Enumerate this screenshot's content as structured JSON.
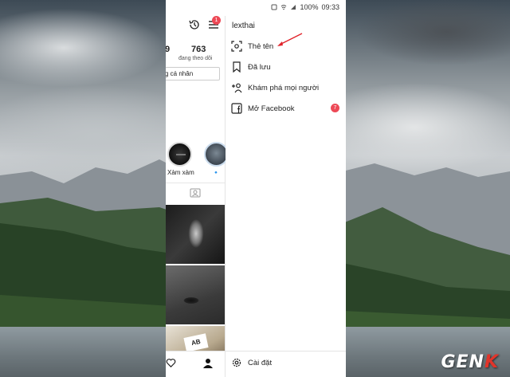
{
  "statusbar": {
    "time": "09:33",
    "battery": "100%"
  },
  "profile": {
    "stat_value": "763",
    "stat_label": "đang theo dõi",
    "left_value": "9",
    "edit_button": "g cá nhân",
    "menu_badge": "1",
    "highlights": [
      {
        "label": "Xàm xàm"
      },
      {
        "label": "🔹"
      }
    ],
    "photo_card_text": "AB"
  },
  "drawer": {
    "username": "lexthai",
    "items": [
      {
        "label": "Thẻ tên",
        "icon": "nametag-icon"
      },
      {
        "label": "Đã lưu",
        "icon": "bookmark-icon"
      },
      {
        "label": "Khám phá mọi người",
        "icon": "add-person-icon"
      },
      {
        "label": "Mở Facebook",
        "icon": "facebook-icon",
        "badge": "7"
      }
    ],
    "settings_label": "Cài đặt"
  },
  "watermark": {
    "text_main": "GEN",
    "text_accent": "K",
    "accent_color": "#e2342a"
  },
  "colors": {
    "badge": "#ed4956",
    "link": "#3897f0",
    "annotation_arrow": "#e0232b"
  }
}
